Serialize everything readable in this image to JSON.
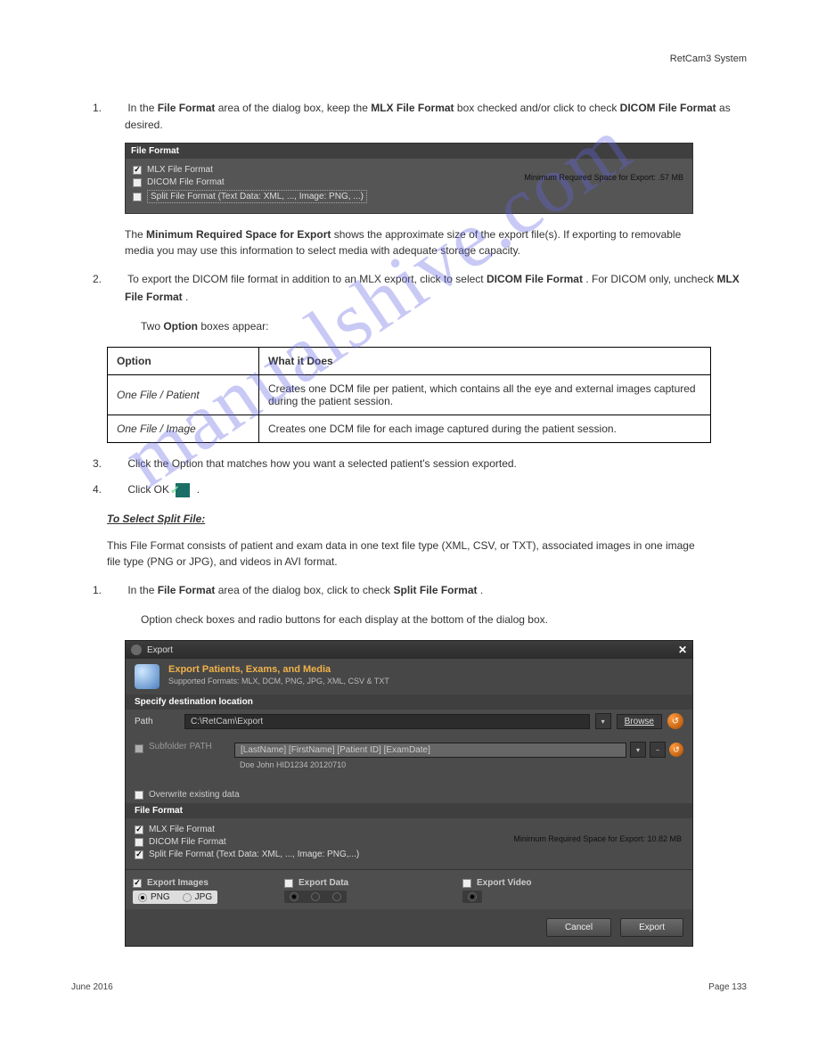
{
  "header": {
    "product": "RetCam3 System"
  },
  "step1": {
    "num": "1.",
    "text_a": "In the ",
    "term": "File Format",
    "text_b": " area of the dialog box, ",
    "keep": "keep the ",
    "mlx": "MLX File Format",
    "text_c": " box checked and/or click to check ",
    "dcm": "DICOM File Format",
    "text_d": " as desired."
  },
  "panel1": {
    "header": "File Format",
    "opt1": "MLX File Format",
    "opt2": "DICOM File Format",
    "opt3": "Split File Format (Text Data: XML, ..., Image: PNG, ...)",
    "note": "Minimum Required Space for Export: .57 MB"
  },
  "filesize": {
    "label_a": "The ",
    "label_req": "Minimum Required Space for Export",
    "label_b": " shows the approximate size of the export file(s). If exporting to removable media you may use this information to select media with adequate storage capacity."
  },
  "step2": {
    "num": "2.",
    "text_a": "To export the DICOM file format in addition to an MLX export, click to select ",
    "dcm": "DICOM File Format",
    "text_b": ". For DICOM only, uncheck ",
    "mlx": "MLX File Format",
    "period": ".",
    "preline": "Two ",
    "opt": "Option",
    "postline": " boxes appear:"
  },
  "table": {
    "h1": "Option",
    "h2": "What it Does",
    "r1a": "One File / Patient",
    "r1b": "Creates one DCM file per patient, which contains all the eye and external images captured during the patient session.",
    "r2a": "One File / Image",
    "r2b": "Creates one DCM file for each image captured during the patient session."
  },
  "steps34": {
    "s3num": "3.",
    "s3": "Click the Option that matches how you want a selected patient's session exported.",
    "s4num": "4.",
    "s4a": "Click OK ",
    "s4b": "."
  },
  "subheader": "To Select Split File:",
  "split_intro": "This File Format consists of patient and exam data in one text file type (XML, CSV, or TXT), associated images in one image file type (PNG or JPG), and videos in AVI format.",
  "split1": {
    "num": "1.",
    "text_a": "In the ",
    "ff": "File Format",
    "text_b": " area of the dialog box, click to check ",
    "sff": "Split File Format",
    "period": ".",
    "after": "Option check boxes and radio buttons for each display at the bottom of the dialog box."
  },
  "dialog": {
    "title": "Export",
    "banner": {
      "title": "Export Patients, Exams, and Media",
      "sub": "Supported Formats: MLX, DCM, PNG, JPG, XML, CSV & TXT"
    },
    "sec_dest": "Specify destination location",
    "path_lbl": "Path",
    "path_val": "C:\\RetCam\\Export",
    "browse": "Browse",
    "subfolder_lbl": "Subfolder PATH",
    "subfolder_val": "[LastName] [FirstName] [Patient ID] [ExamDate]",
    "example": "Doe John HID1234 20120710",
    "overwrite": "Overwrite existing data",
    "ff_hdr": "File Format",
    "opt1": "MLX File Format",
    "opt2": "DICOM File Format",
    "opt3": "Split File Format (Text Data: XML, ..., Image: PNG,...)",
    "space": "Minimum Required Space for Export: 10.82 MB",
    "export_images": "Export Images",
    "export_data": "Export Data",
    "img_png": "PNG",
    "img_jpg": "JPG",
    "export_video": "Export Video",
    "cancel": "Cancel",
    "export_btn": "Export"
  },
  "footer": {
    "date": "June 2016",
    "page": "Page 133"
  },
  "watermark": "manualshive.com"
}
